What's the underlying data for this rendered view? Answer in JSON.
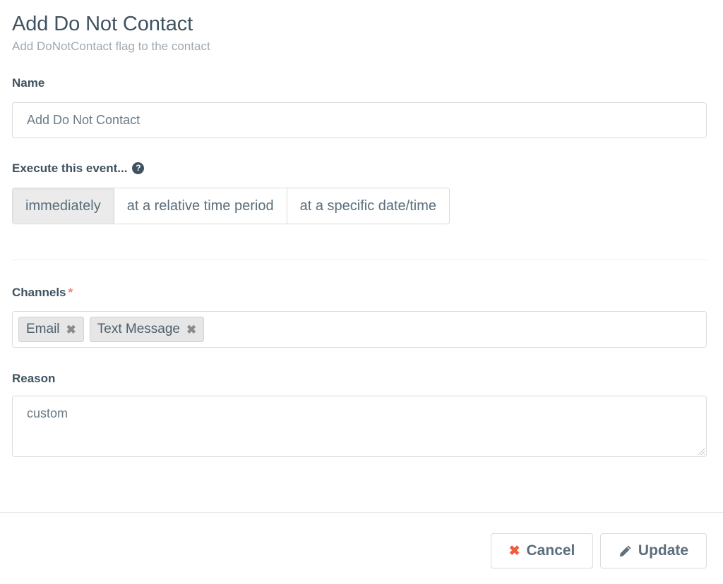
{
  "header": {
    "title": "Add Do Not Contact",
    "subtitle": "Add DoNotContact flag to the contact"
  },
  "name_field": {
    "label": "Name",
    "value": "Add Do Not Contact",
    "placeholder": "Add Do Not Contact"
  },
  "execute": {
    "label": "Execute this event...",
    "help_icon": "question-circle-icon",
    "help_glyph": "?",
    "options": [
      {
        "label": "immediately",
        "active": true
      },
      {
        "label": "at a relative time period",
        "active": false
      },
      {
        "label": "at a specific date/time",
        "active": false
      }
    ]
  },
  "channels": {
    "label": "Channels",
    "required_marker": "*",
    "required_color": "#f4836e",
    "tokens": [
      {
        "label": "Email",
        "remove_icon": "close-icon",
        "remove_glyph": "✖"
      },
      {
        "label": "Text Message",
        "remove_icon": "close-icon",
        "remove_glyph": "✖"
      }
    ]
  },
  "reason": {
    "label": "Reason",
    "value": "custom",
    "placeholder": "custom"
  },
  "footer": {
    "cancel": {
      "label": "Cancel",
      "icon": "close-icon",
      "glyph": "✖",
      "color": "#ef5b3c"
    },
    "update": {
      "label": "Update",
      "icon": "pencil-icon"
    }
  }
}
